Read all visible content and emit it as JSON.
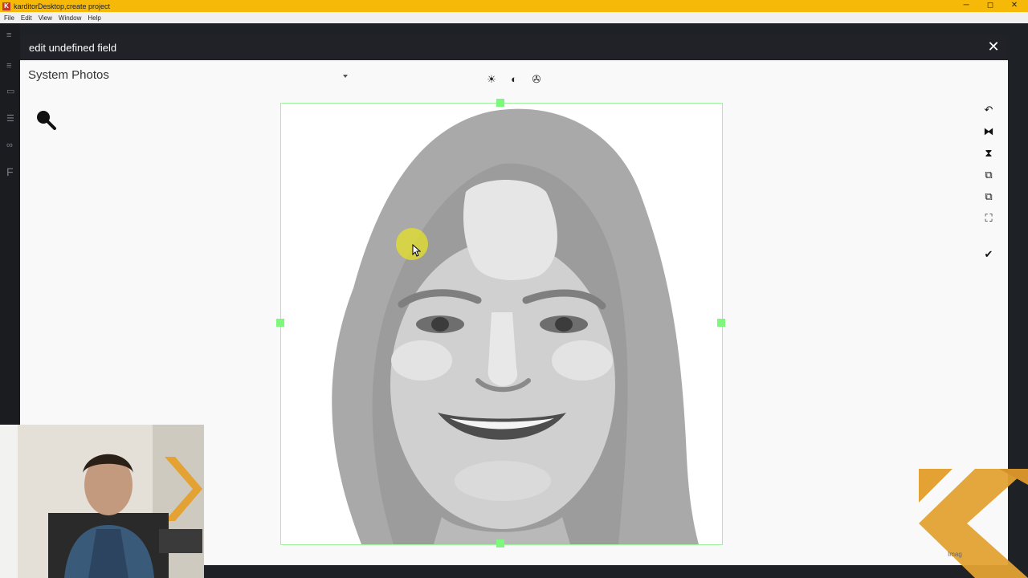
{
  "window": {
    "title": "karditorDesktop,create project",
    "app_icon": "K",
    "controls": {
      "minimize": "─",
      "maximize": "◻",
      "close": "✕"
    }
  },
  "menu": [
    "File",
    "Edit",
    "View",
    "Window",
    "Help"
  ],
  "modal": {
    "title": "edit undefined field",
    "close_glyph": "✕"
  },
  "source_select": {
    "selected": "System Photos"
  },
  "adjust_tools": [
    {
      "icon": "brightness-icon",
      "glyph": "☀"
    },
    {
      "icon": "contrast-icon",
      "glyph": "◐"
    },
    {
      "icon": "color-channels-icon",
      "glyph": "✇"
    }
  ],
  "right_tools": [
    {
      "icon": "rotate-icon",
      "glyph": "↶"
    },
    {
      "icon": "flip-horizontal-icon",
      "glyph": "⧓"
    },
    {
      "icon": "flip-vertical-icon",
      "glyph": "⧗"
    },
    {
      "icon": "copy-icon",
      "glyph": "⧉"
    },
    {
      "icon": "paste-icon",
      "glyph": "⧉"
    },
    {
      "icon": "fullscreen-icon",
      "glyph": "⛶"
    },
    {
      "icon": "confirm-check-icon",
      "glyph": "✔"
    }
  ],
  "brand": {
    "partial_text": "Imag",
    "color": "#e3a233"
  },
  "colors": {
    "titlebar": "#f7b908",
    "handle": "#7ef77e",
    "modal_header": "#202227"
  }
}
